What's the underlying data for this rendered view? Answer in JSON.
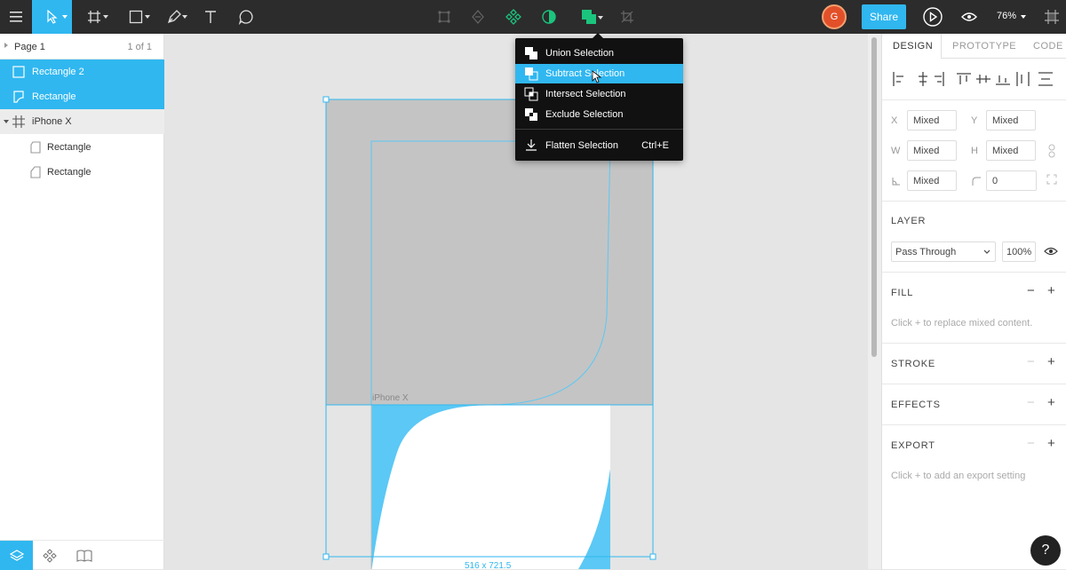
{
  "toolbar": {
    "share_label": "Share",
    "avatar_initial": "G",
    "zoom": "76%"
  },
  "pages": {
    "current": "Page 1",
    "count": "1 of 1"
  },
  "layers": [
    {
      "name": "Rectangle 2",
      "state": "selected"
    },
    {
      "name": "Rectangle",
      "state": "selected"
    },
    {
      "name": "iPhone X",
      "state": "frame"
    },
    {
      "name": "Rectangle",
      "state": "child"
    },
    {
      "name": "Rectangle",
      "state": "child"
    }
  ],
  "canvas": {
    "frame_label": "iPhone X",
    "dimension_label": "516 x 721.5"
  },
  "boolean_menu": {
    "items": [
      {
        "label": "Union Selection",
        "shortcut": ""
      },
      {
        "label": "Subtract Selection",
        "shortcut": ""
      },
      {
        "label": "Intersect Selection",
        "shortcut": ""
      },
      {
        "label": "Exclude Selection",
        "shortcut": ""
      }
    ],
    "flatten": {
      "label": "Flatten Selection",
      "shortcut": "Ctrl+E"
    }
  },
  "right_panel": {
    "tabs": [
      "DESIGN",
      "PROTOTYPE",
      "CODE"
    ],
    "x_label": "X",
    "x_value": "Mixed",
    "y_label": "Y",
    "y_value": "Mixed",
    "w_label": "W",
    "w_value": "Mixed",
    "h_label": "H",
    "h_value": "Mixed",
    "rotation_value": "Mixed",
    "radius_value": "0",
    "layer_title": "LAYER",
    "blend_mode": "Pass Through",
    "opacity": "100%",
    "fill_title": "FILL",
    "fill_hint": "Click + to replace mixed content.",
    "stroke_title": "STROKE",
    "effects_title": "EFFECTS",
    "export_title": "EXPORT",
    "export_hint": "Click + to add an export setting"
  },
  "colors": {
    "accent": "#30b7f0",
    "toolbar_bg": "#2c2c2c",
    "selection_blue": "#5bc8f5",
    "frame_gray": "#c4c4c4"
  },
  "help_label": "?"
}
